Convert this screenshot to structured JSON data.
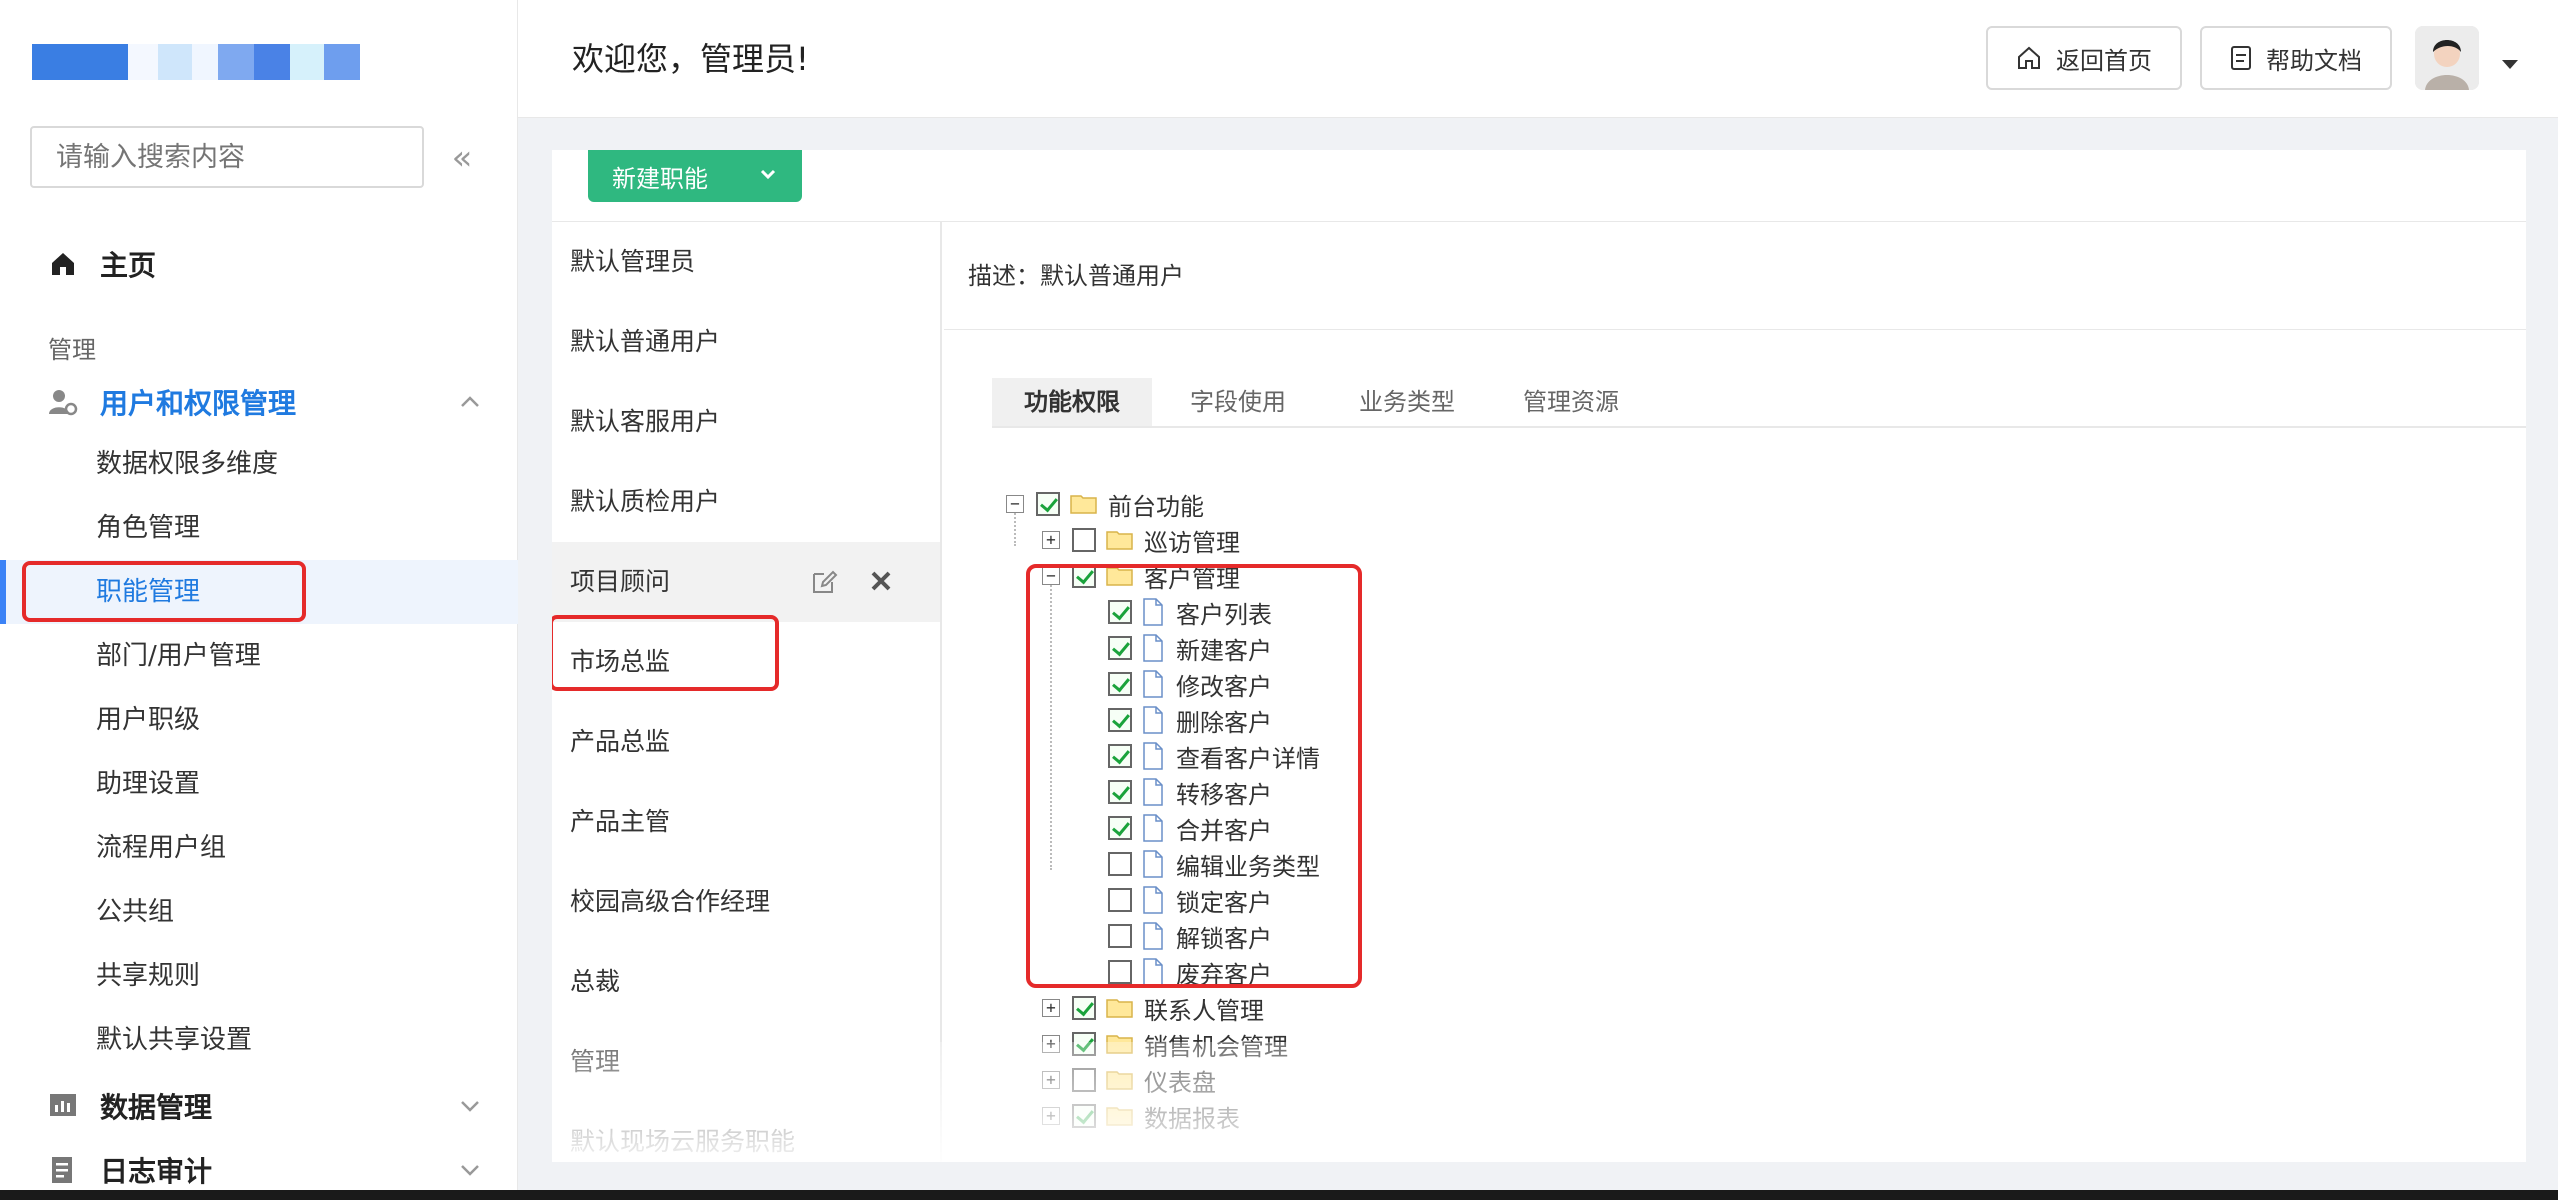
{
  "header": {
    "welcome": "欢迎您，管理员!",
    "home_btn": "返回首页",
    "help_btn": "帮助文档"
  },
  "sidebar": {
    "search_placeholder": "请输入搜索内容",
    "home": "主页",
    "section": "管理",
    "group_user": "用户和权限管理",
    "items": [
      "数据权限多维度",
      "角色管理",
      "职能管理",
      "部门/用户管理",
      "用户职级",
      "助理设置",
      "流程用户组",
      "公共组",
      "共享规则",
      "默认共享设置"
    ],
    "group_data": "数据管理",
    "group_log": "日志审计"
  },
  "toolbar": {
    "new_role": "新建职能"
  },
  "roles": [
    "默认管理员",
    "默认普通用户",
    "默认客服用户",
    "默认质检用户",
    "项目顾问",
    "市场总监",
    "产品总监",
    "产品主管",
    "校园高级合作经理",
    "总裁",
    "管理",
    "默认现场云服务职能"
  ],
  "detail": {
    "description": "描述：默认普通用户",
    "tabs": [
      "功能权限",
      "字段使用",
      "业务类型",
      "管理资源"
    ]
  },
  "tree": {
    "root": "前台功能",
    "visit": "巡访管理",
    "customer": "客户管理",
    "customer_children": [
      "客户列表",
      "新建客户",
      "修改客户",
      "删除客户",
      "查看客户详情",
      "转移客户",
      "合并客户",
      "编辑业务类型",
      "锁定客户",
      "解锁客户",
      "废弃客户"
    ],
    "contacts": "联系人管理",
    "opportunity": "销售机会管理",
    "dashboard": "仪表盘",
    "report": "数据报表"
  },
  "colors": {
    "accent": "#1f7ae0",
    "primary_btn": "#2fb880",
    "highlight": "#e52a2a",
    "check": "#1aa33b"
  }
}
